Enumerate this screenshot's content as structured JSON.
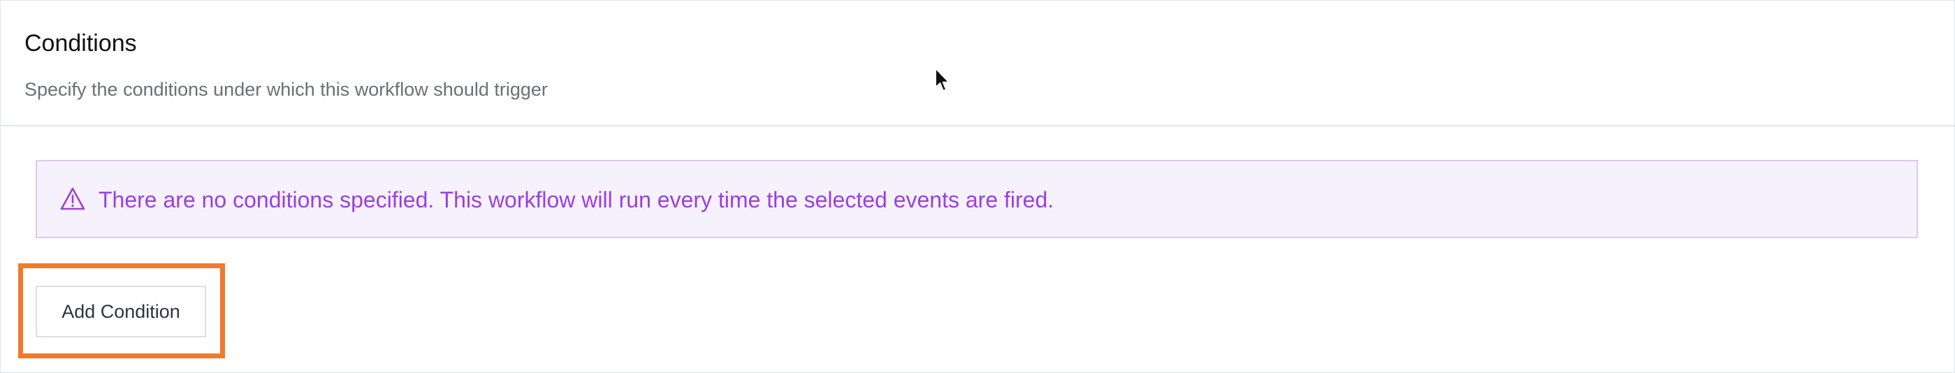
{
  "conditions_panel": {
    "title": "Conditions",
    "subtitle": "Specify the conditions under which this workflow should trigger"
  },
  "alert": {
    "icon": "warning-triangle-icon",
    "message": "There are no conditions specified. This workflow will run every time the selected events are fired.",
    "color": "#9b3fe0",
    "background": "#f6f2fd"
  },
  "actions": {
    "add_condition_label": "Add Condition"
  },
  "annotation": {
    "highlight_color": "#f07a2e"
  }
}
